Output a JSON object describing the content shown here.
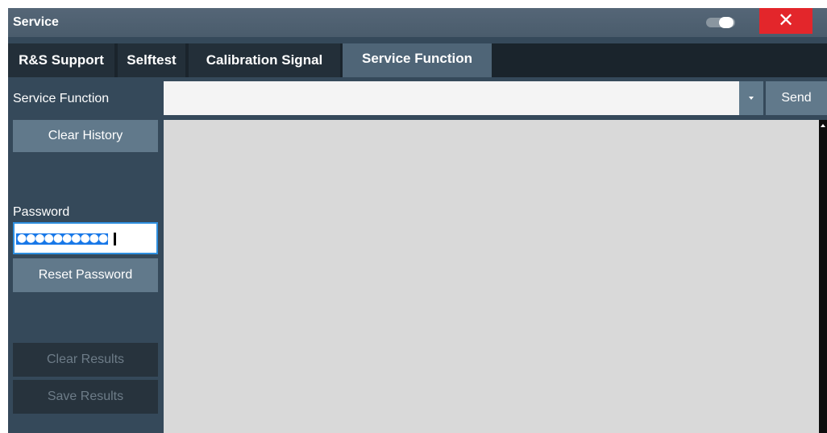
{
  "window": {
    "title": "Service",
    "close_label": "✕"
  },
  "tabs": [
    {
      "label": "R&S Support",
      "active": false
    },
    {
      "label": "Selftest",
      "active": false
    },
    {
      "label": "Calibration Signal",
      "active": false
    },
    {
      "label": "Service Function",
      "active": true
    }
  ],
  "service_function": {
    "label": "Service Function",
    "value": "",
    "send_label": "Send"
  },
  "buttons": {
    "clear_history": "Clear History",
    "reset_password": "Reset Password",
    "clear_results": "Clear Results",
    "save_results": "Save Results"
  },
  "password": {
    "label": "Password",
    "masked_value": "●●●●●●●●●●"
  },
  "colors": {
    "accent": "#2f8fdf",
    "close": "#e3262b",
    "active_tab": "#4f6577"
  }
}
